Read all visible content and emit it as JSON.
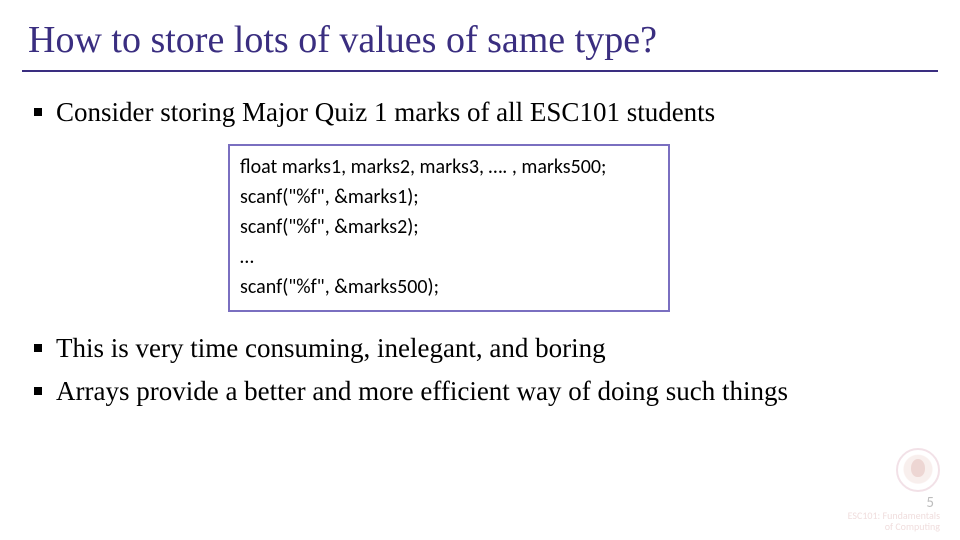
{
  "title": "How to store lots of values of same type?",
  "bullets": {
    "b0": "Consider storing Major Quiz 1 marks of all ESC101 students",
    "b1": "This is very time consuming, inelegant, and boring",
    "b2": "Arrays provide a better and more efficient way of doing such things"
  },
  "code": {
    "l0": "float marks1, marks2, marks3, …. , marks500;",
    "l1": "scanf(\"%f\", &marks1);",
    "l2": "scanf(\"%f\", &marks2);",
    "l3": "…",
    "l4": "scanf(\"%f\", &marks500);"
  },
  "footer": {
    "page": "5",
    "course_line1": "ESC101: Fundamentals",
    "course_line2": "of Computing"
  }
}
